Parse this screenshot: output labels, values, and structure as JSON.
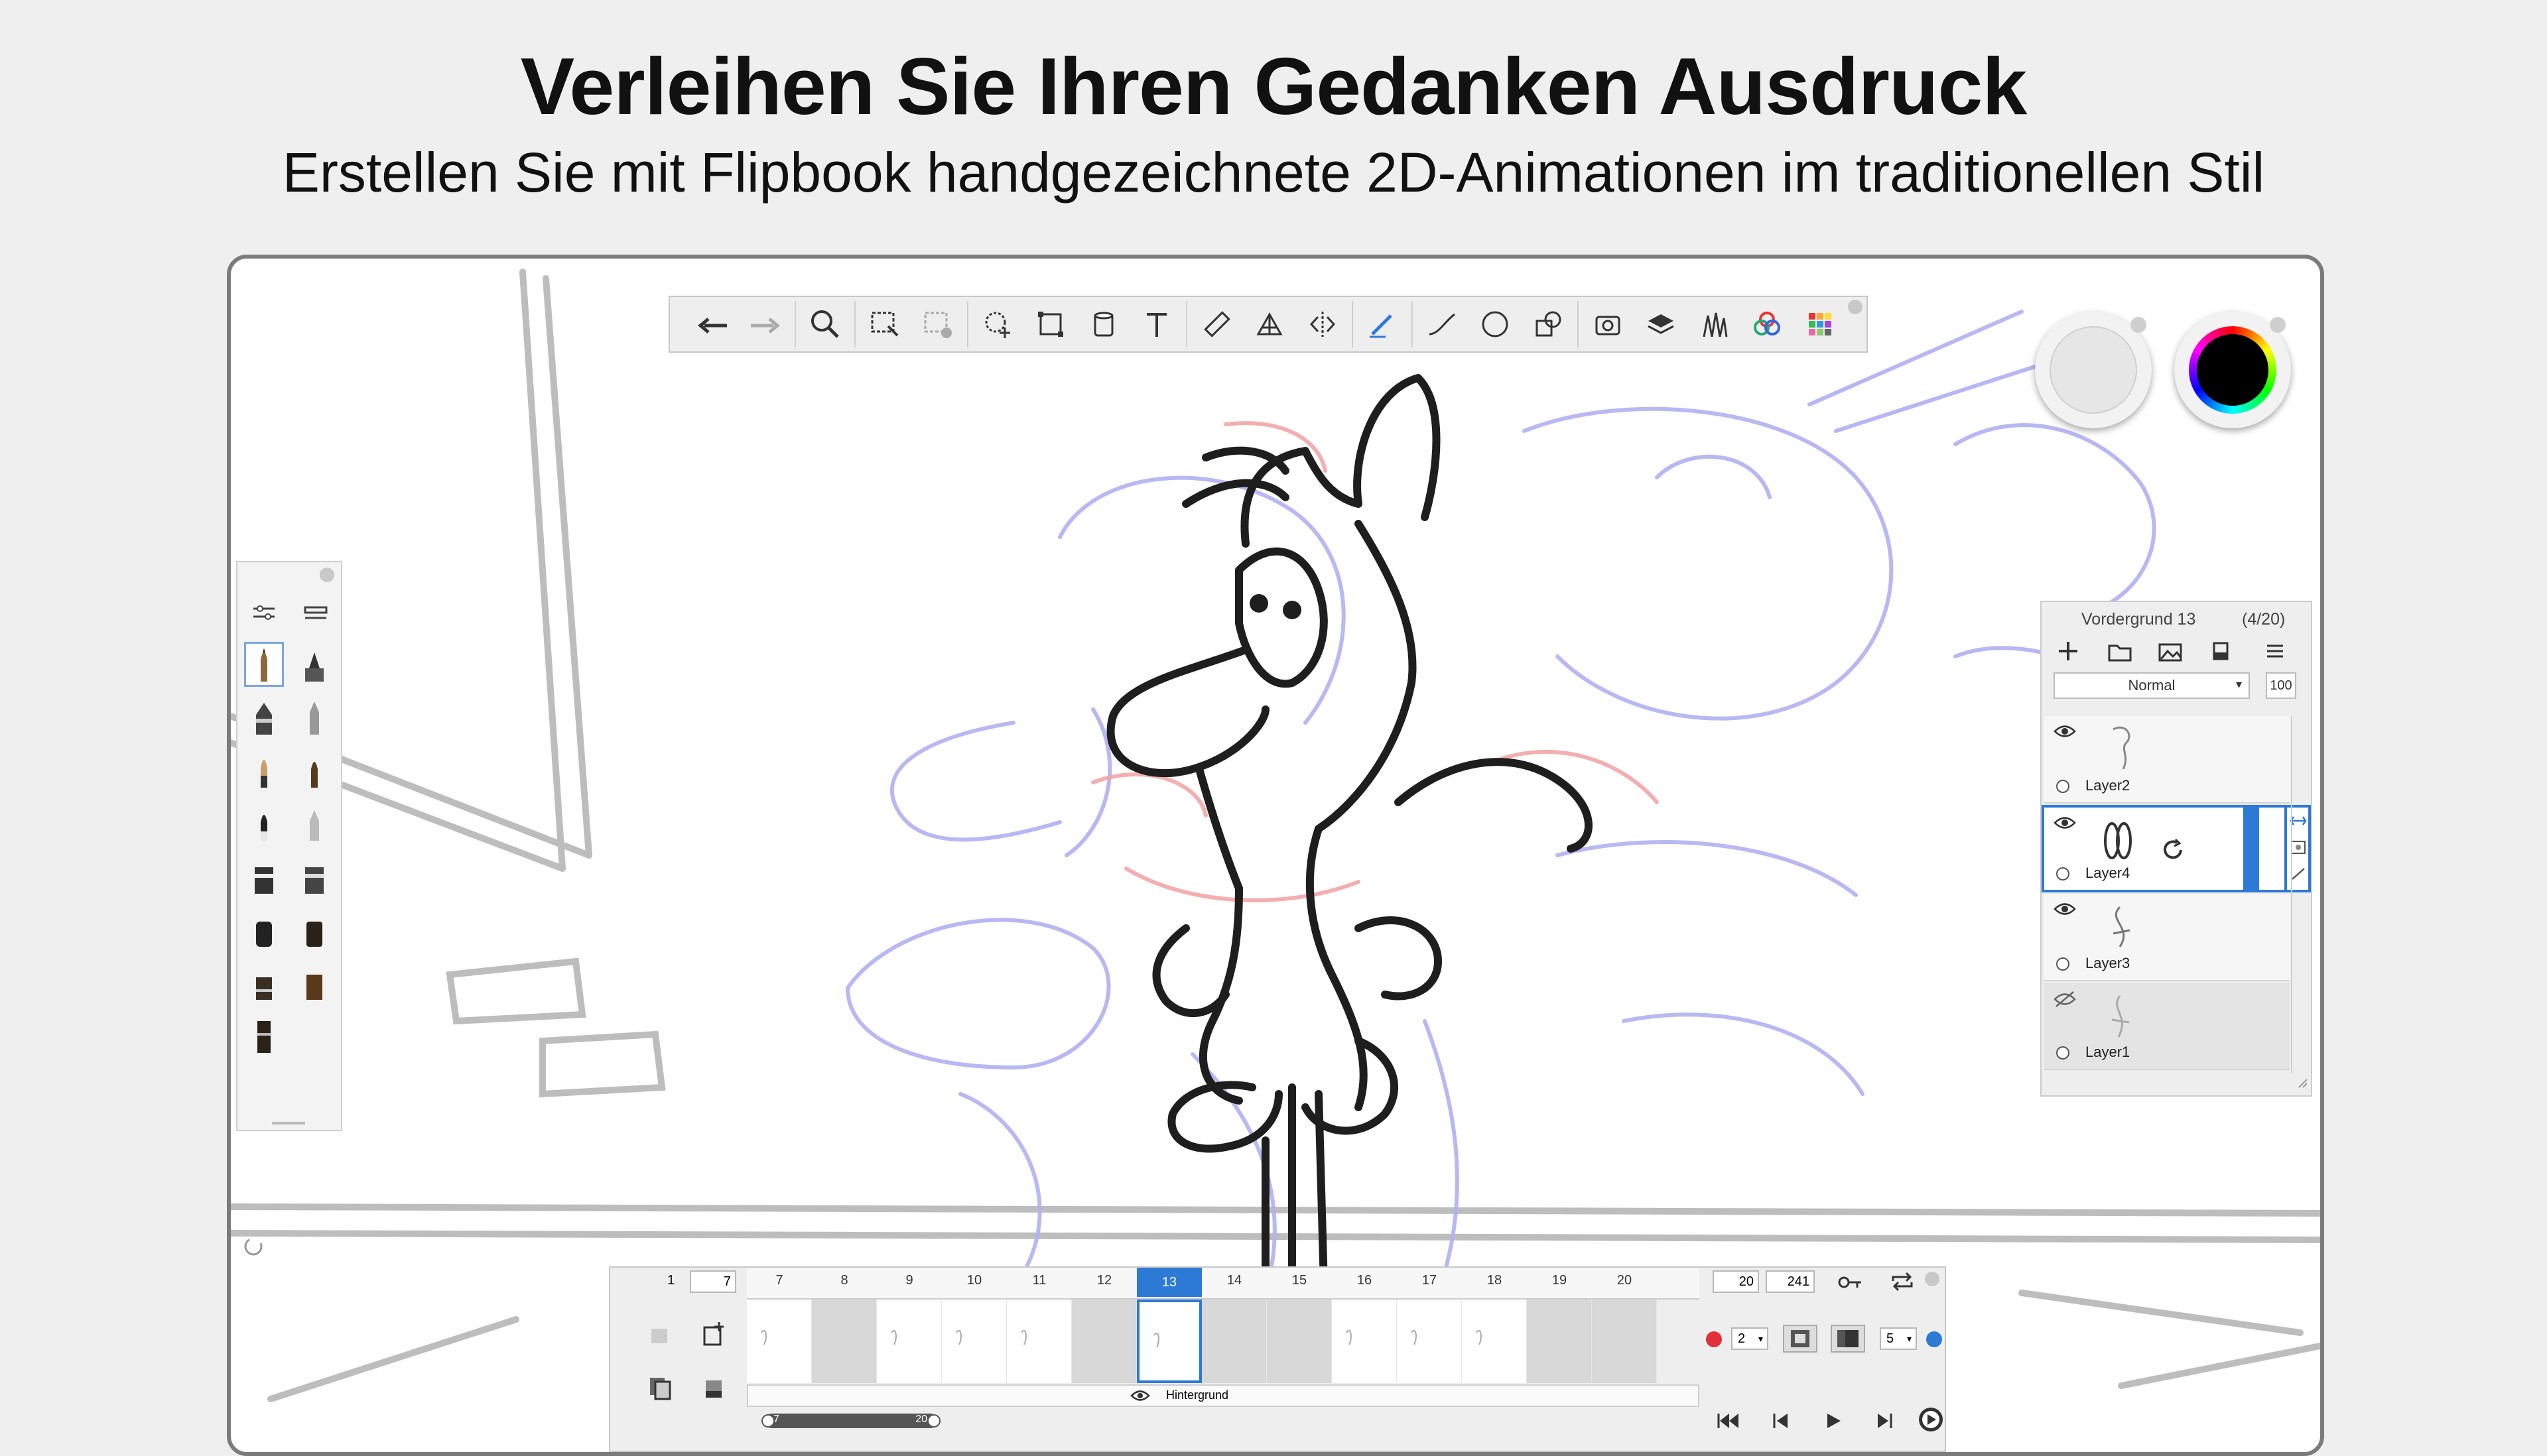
{
  "hero": {
    "title": "Verleihen Sie Ihren Gedanken Ausdruck",
    "subtitle": "Erstellen Sie mit Flipbook handgezeichnete 2D-Animationen im traditionellen Stil"
  },
  "toolbar": {
    "tools": [
      "undo-icon",
      "redo-icon",
      "zoom-icon",
      "select-rect-icon",
      "select-clear-icon",
      "transform-icon",
      "crop-icon",
      "fill-bucket-icon",
      "text-icon",
      "ruler-icon",
      "perspective-icon",
      "symmetry-icon",
      "pen-stroke-icon",
      "curve-icon",
      "ellipse-icon",
      "shapes-icon",
      "time-lapse-icon",
      "layers-icon",
      "brush-library-icon",
      "color-wheel-icon",
      "swatches-icon"
    ]
  },
  "colors": {
    "accent": "#2d7ad6",
    "current_color": "#000000",
    "secondary_color": "#e6e6e6",
    "record": "#e0303a",
    "sketch_blue": "#a9a9f4",
    "sketch_red": "#f0a0a0"
  },
  "layers": {
    "header_name": "Vordergrund  13",
    "header_count": "(4/20)",
    "blend_mode": "Normal",
    "opacity": "100",
    "items": [
      {
        "label": "Layer2",
        "visible": true,
        "active": false
      },
      {
        "label": "Layer4",
        "visible": true,
        "active": true
      },
      {
        "label": "Layer3",
        "visible": true,
        "active": false
      },
      {
        "label": "Layer1",
        "visible": false,
        "active": false
      }
    ]
  },
  "timeline": {
    "start_frame": "1",
    "frame_field": "7",
    "frame_numbers": [
      "7",
      "8",
      "9",
      "10",
      "11",
      "12",
      "13",
      "14",
      "15",
      "16",
      "17",
      "18",
      "19",
      "20"
    ],
    "current_frame": "13",
    "end_field": "20",
    "total_field": "241",
    "background_label": "Hintergrund",
    "range_start": "7",
    "range_end": "20",
    "ghost_before": "2",
    "ghost_after": "5"
  }
}
